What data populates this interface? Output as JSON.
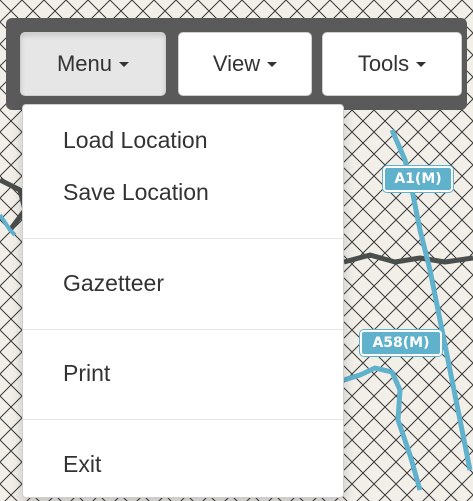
{
  "toolbar": {
    "menu_label": "Menu",
    "view_label": "View",
    "tools_label": "Tools"
  },
  "dropdown": {
    "items": [
      {
        "label": "Load Location"
      },
      {
        "label": "Save Location"
      },
      {
        "label": "Gazetteer"
      },
      {
        "label": "Print"
      },
      {
        "label": "Exit"
      }
    ]
  },
  "map": {
    "road_labels": [
      "A1(M)",
      "A58(M)"
    ],
    "colors": {
      "road": "#5fb1cc",
      "boundary": "#4a4f4d",
      "hatch": "#3a3a3a",
      "land": "#f2efe9"
    }
  }
}
